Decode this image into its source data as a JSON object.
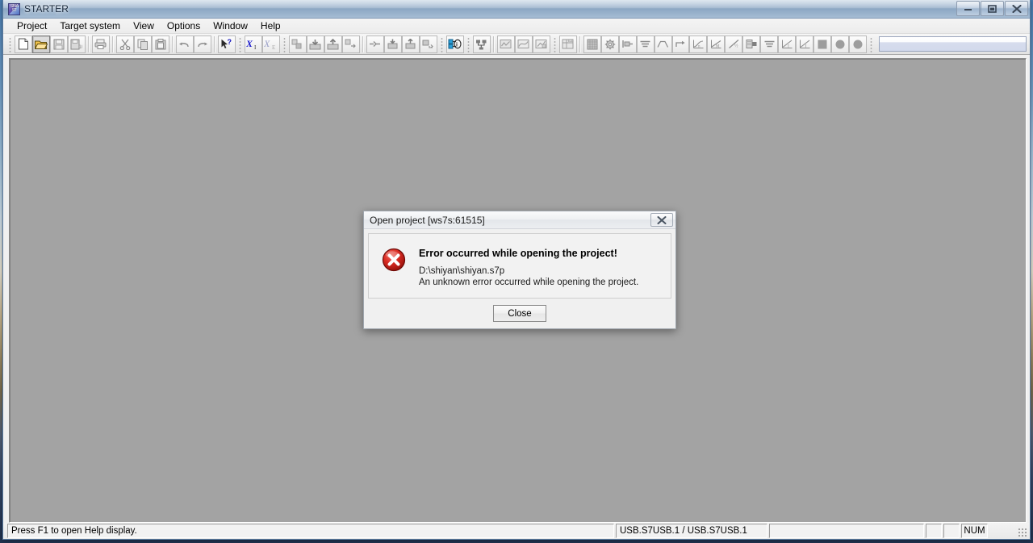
{
  "window": {
    "title": "STARTER",
    "icon": "sinamics-starter-icon",
    "controls": [
      {
        "name": "minimize-button",
        "glyph": "minimize-icon"
      },
      {
        "name": "maximize-button",
        "glyph": "maximize-icon"
      },
      {
        "name": "close-button",
        "glyph": "close-icon"
      }
    ]
  },
  "menu": {
    "items": [
      {
        "label": "Project"
      },
      {
        "label": "Target system"
      },
      {
        "label": "View"
      },
      {
        "label": "Options"
      },
      {
        "label": "Window"
      },
      {
        "label": "Help"
      }
    ]
  },
  "toolbar": {
    "groups": [
      {
        "buttons": [
          {
            "name": "new-project-button",
            "icon": "new-document-icon",
            "enabled": true,
            "pressed": false
          },
          {
            "name": "open-project-button",
            "icon": "open-folder-icon",
            "enabled": true,
            "pressed": true
          },
          {
            "name": "save-project-button",
            "icon": "floppy-save-icon",
            "enabled": false,
            "pressed": false
          },
          {
            "name": "save-compile-button",
            "icon": "floppy-compile-icon",
            "enabled": false,
            "pressed": false
          }
        ]
      },
      {
        "buttons": [
          {
            "name": "print-button",
            "icon": "printer-icon",
            "enabled": false,
            "pressed": false
          }
        ]
      },
      {
        "buttons": [
          {
            "name": "cut-button",
            "icon": "scissors-icon",
            "enabled": false,
            "pressed": false
          },
          {
            "name": "copy-button",
            "icon": "copy-pages-icon",
            "enabled": false,
            "pressed": false
          },
          {
            "name": "paste-button",
            "icon": "clipboard-paste-icon",
            "enabled": false,
            "pressed": false
          }
        ]
      },
      {
        "buttons": [
          {
            "name": "undo-button",
            "icon": "undo-arrow-icon",
            "enabled": false,
            "pressed": false
          },
          {
            "name": "redo-button",
            "icon": "redo-arrow-icon",
            "enabled": false,
            "pressed": false
          }
        ]
      },
      {
        "buttons": [
          {
            "name": "context-help-button",
            "icon": "arrow-question-icon",
            "enabled": true,
            "pressed": false
          }
        ]
      },
      {
        "buttons": [
          {
            "name": "expert-list-xi-button",
            "icon": "xi-symbol-icon",
            "enabled": true,
            "pressed": false
          },
          {
            "name": "expert-list-xe-button",
            "icon": "xe-symbol-icon",
            "enabled": false,
            "pressed": false
          }
        ]
      },
      {
        "buttons": [
          {
            "name": "copy-ram-to-rom-button",
            "icon": "blocks-copy-icon",
            "enabled": false,
            "pressed": false
          },
          {
            "name": "download-to-target-button",
            "icon": "download-box-icon",
            "enabled": false,
            "pressed": false
          },
          {
            "name": "load-to-pg-button",
            "icon": "upload-box-icon",
            "enabled": false,
            "pressed": false
          },
          {
            "name": "compare-button",
            "icon": "blocks-compare-icon",
            "enabled": false,
            "pressed": false
          }
        ]
      },
      {
        "buttons": [
          {
            "name": "connect-disconnect-button",
            "icon": "plug-connect-icon",
            "enabled": false,
            "pressed": false
          },
          {
            "name": "download-cpu-button",
            "icon": "cpu-download-icon",
            "enabled": false,
            "pressed": false
          },
          {
            "name": "upload-cpu-button",
            "icon": "cpu-upload-icon",
            "enabled": false,
            "pressed": false
          },
          {
            "name": "activate-button",
            "icon": "activate-node-icon",
            "enabled": false,
            "pressed": false
          }
        ]
      },
      {
        "buttons": [
          {
            "name": "online-offline-button",
            "icon": "online-link-icon",
            "enabled": true,
            "pressed": false
          }
        ]
      },
      {
        "buttons": [
          {
            "name": "accessible-nodes-button",
            "icon": "nodes-network-icon",
            "enabled": true,
            "pressed": false
          }
        ]
      },
      {
        "buttons": [
          {
            "name": "topology-button",
            "icon": "topology-icon",
            "enabled": false,
            "pressed": false
          },
          {
            "name": "trace-button",
            "icon": "trace-curve-icon",
            "enabled": false,
            "pressed": false
          },
          {
            "name": "diagnostics-button",
            "icon": "diagram-chart-icon",
            "enabled": false,
            "pressed": false
          }
        ]
      },
      {
        "buttons": [
          {
            "name": "device-overview-button",
            "icon": "device-list-icon",
            "enabled": false,
            "pressed": false
          }
        ]
      },
      {
        "buttons": [
          {
            "name": "expert-grid-button",
            "icon": "grid-table-icon",
            "enabled": false,
            "pressed": false
          },
          {
            "name": "settings-gear-button",
            "icon": "gear-settings-icon",
            "enabled": false,
            "pressed": false
          },
          {
            "name": "motor-data-button",
            "icon": "motor-shaft-icon",
            "enabled": false,
            "pressed": false
          },
          {
            "name": "equalize-button",
            "icon": "equalizer-icon",
            "enabled": false,
            "pressed": false
          },
          {
            "name": "ramp-function-button",
            "icon": "ramp-curve-icon",
            "enabled": false,
            "pressed": false
          },
          {
            "name": "jog-button",
            "icon": "jog-arrow-icon",
            "enabled": false,
            "pressed": false
          },
          {
            "name": "speed-curve-button",
            "icon": "speed-curve-n-icon",
            "enabled": false,
            "pressed": false
          },
          {
            "name": "torque-curve-button",
            "icon": "torque-curve-m-icon",
            "enabled": false,
            "pressed": false
          },
          {
            "name": "half-curve-button",
            "icon": "half-curve-icon",
            "enabled": false,
            "pressed": false
          },
          {
            "name": "memory-card-button",
            "icon": "memory-card-icon",
            "enabled": false,
            "pressed": false
          },
          {
            "name": "equalize-2-button",
            "icon": "equalizer-2-icon",
            "enabled": false,
            "pressed": false
          },
          {
            "name": "current-curve-button",
            "icon": "current-curve-i-icon",
            "enabled": false,
            "pressed": false
          },
          {
            "name": "current-curve-2-button",
            "icon": "current-curve-i2-icon",
            "enabled": false,
            "pressed": false
          },
          {
            "name": "stop-square-button",
            "icon": "stop-square-icon",
            "enabled": false,
            "pressed": false
          },
          {
            "name": "record-circle-button",
            "icon": "record-circle-icon",
            "enabled": false,
            "pressed": false
          },
          {
            "name": "record-circle-2-button",
            "icon": "record-circle-2-icon",
            "enabled": false,
            "pressed": false
          }
        ]
      }
    ],
    "input_field_value": ""
  },
  "dialog": {
    "title": "Open project [ws7s:61515]",
    "close_glyph": "close-icon",
    "icon": "error-cross-icon",
    "heading": "Error occurred while opening the project!",
    "line1": "D:\\shiyan\\shiyan.s7p",
    "line2": "An unknown error occurred while opening the project.",
    "button_label": "Close"
  },
  "status_bar": {
    "message": "Press F1 to open Help display.",
    "connection": "USB.S7USB.1 / USB.S7USB.1",
    "blank1": "",
    "small1": "",
    "small2": "",
    "num_indicator": "NUM"
  },
  "colors": {
    "client_background": "#a3a3a3",
    "dialog_background": "#f0f0f0",
    "error_red": "#cc2222",
    "title_bar_blue": "#9db4cd"
  }
}
